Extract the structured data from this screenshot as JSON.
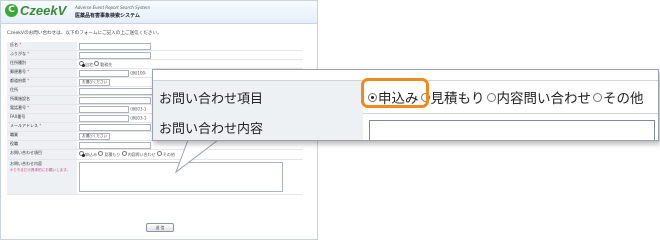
{
  "header": {
    "logo_text": "CzeekV",
    "logo_mark": "C",
    "subtitle_en": "Adverse Event Report Search System",
    "subtitle_jp": "医薬品有害事象検索システム"
  },
  "intro": "CzeekVのお問い合わせは、以下のフォームにご記入の上ご送信ください。",
  "form": {
    "rows": {
      "name": "氏名",
      "furigana": "ふりがな",
      "address_type": "住所種別",
      "address_type_options": [
        "自宅",
        "勤務先"
      ],
      "postal": "郵便番号",
      "postal_hint": "(例)100-",
      "prefecture": "都道府県",
      "select_placeholder": "お選びください",
      "address": "住所",
      "org": "所属施設名",
      "phone": "電話番号",
      "phone_hint": "(例)03-1",
      "fax": "FAX番号",
      "fax_hint": "(例)03-1",
      "email": "メールアドレス",
      "job": "職業",
      "title": "役職",
      "inquiry_type": "お問い合わせ項目",
      "inquiry_options": [
        "申込み",
        "見積もり",
        "内容問い合わせ",
        "その他"
      ],
      "inquiry_content": "お問い合わせ内容",
      "inquiry_note": "※できるだけ具体的にお願いします。"
    },
    "required_mark": "*",
    "submit_label": "送 信"
  },
  "callout": {
    "inquiry_label": "お問い合わせ項目",
    "inquiry_options": [
      "申込み",
      "見積もり",
      "内容問い合わせ",
      "その他"
    ],
    "selected_option": "申込み",
    "content_label": "お問い合わせ内容",
    "highlight_color": "#f08a1c"
  }
}
